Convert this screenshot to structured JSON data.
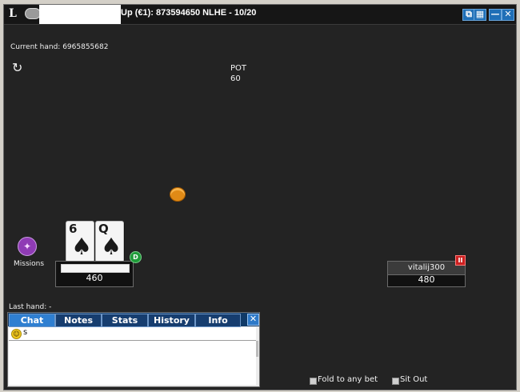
{
  "window": {
    "title": "Up (€1): 873594650 NLHE - 10/20",
    "logo_letter": "L",
    "buttons": [
      "⧉",
      "▦",
      "—",
      "✕"
    ]
  },
  "table": {
    "current_hand": "Current hand: 6965855682",
    "pot_label": "POT",
    "pot_value": "60",
    "missions_label": "Missions",
    "last_hand": "Last hand: -"
  },
  "hero": {
    "stack": "460",
    "cards": [
      {
        "rank": "6",
        "suit": "♠"
      },
      {
        "rank": "Q",
        "suit": "♠"
      }
    ],
    "dealer_button": "D"
  },
  "opponent": {
    "name": "vitalij300",
    "stack": "480",
    "badge": "II"
  },
  "chat": {
    "tabs": [
      "Chat",
      "Notes",
      "Stats",
      "History",
      "Info"
    ],
    "active_tab": "Chat",
    "input_text": "s",
    "close_label": "✕"
  },
  "options": {
    "fold_to_any_bet": "Fold to any bet",
    "sit_out": "Sit Out"
  },
  "colors": {
    "table_bg": "#232323",
    "title_bg": "#161616",
    "tab_active": "#2f7fd1",
    "tab_bg": "#163d6f"
  }
}
